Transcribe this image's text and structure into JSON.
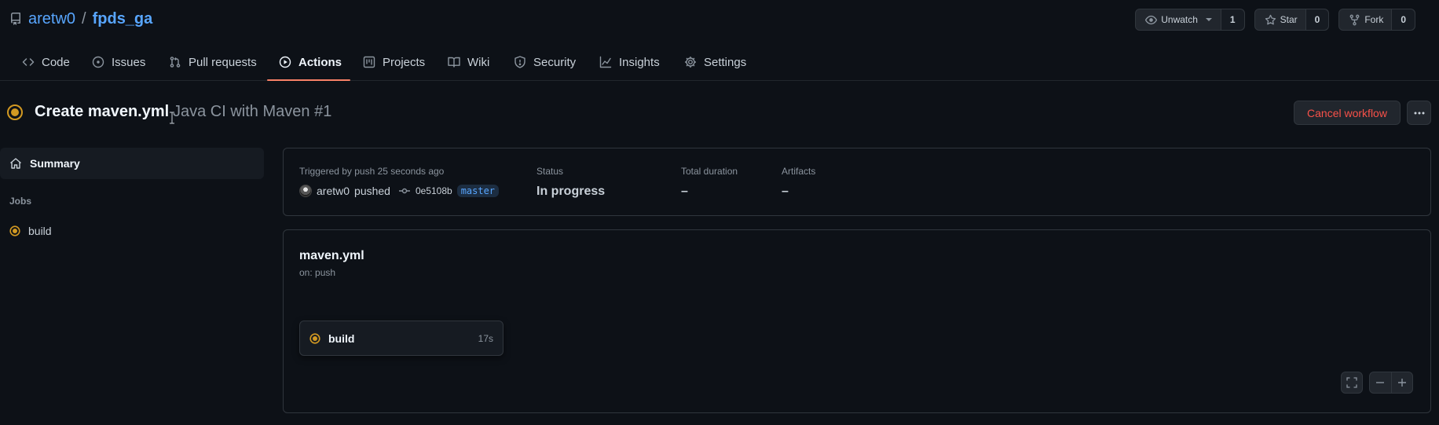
{
  "repo": {
    "owner": "aretw0",
    "separator": "/",
    "name": "fpds_ga"
  },
  "header_buttons": {
    "watch": {
      "label": "Unwatch",
      "count": "1"
    },
    "star": {
      "label": "Star",
      "count": "0"
    },
    "fork": {
      "label": "Fork",
      "count": "0"
    }
  },
  "tabs": [
    {
      "label": "Code",
      "icon": "code-icon"
    },
    {
      "label": "Issues",
      "icon": "issue-opened-icon"
    },
    {
      "label": "Pull requests",
      "icon": "git-pull-request-icon"
    },
    {
      "label": "Actions",
      "icon": "play-icon",
      "active": true
    },
    {
      "label": "Projects",
      "icon": "project-icon"
    },
    {
      "label": "Wiki",
      "icon": "book-icon"
    },
    {
      "label": "Security",
      "icon": "shield-icon"
    },
    {
      "label": "Insights",
      "icon": "graph-icon"
    },
    {
      "label": "Settings",
      "icon": "gear-icon"
    }
  ],
  "run": {
    "title": "Create maven.yml",
    "subtitle": "Java CI with Maven #1",
    "cancel_label": "Cancel workflow"
  },
  "sidebar": {
    "summary_label": "Summary",
    "jobs_heading": "Jobs",
    "jobs": [
      {
        "name": "build"
      }
    ]
  },
  "summary": {
    "trigger_label": "Triggered by push 25 seconds ago",
    "actor": "aretw0",
    "action": "pushed",
    "commit_sha": "0e5108b",
    "branch": "master",
    "status_label": "Status",
    "status_value": "In progress",
    "duration_label": "Total duration",
    "duration_value": "–",
    "artifacts_label": "Artifacts",
    "artifacts_value": "–"
  },
  "workflow": {
    "file": "maven.yml",
    "trigger": "on: push",
    "job": {
      "name": "build",
      "duration": "17s"
    }
  },
  "colors": {
    "background": "#0d1117",
    "link": "#58a6ff",
    "in_progress": "#d29922",
    "danger": "#f85149",
    "tab_underline": "#f78166"
  }
}
